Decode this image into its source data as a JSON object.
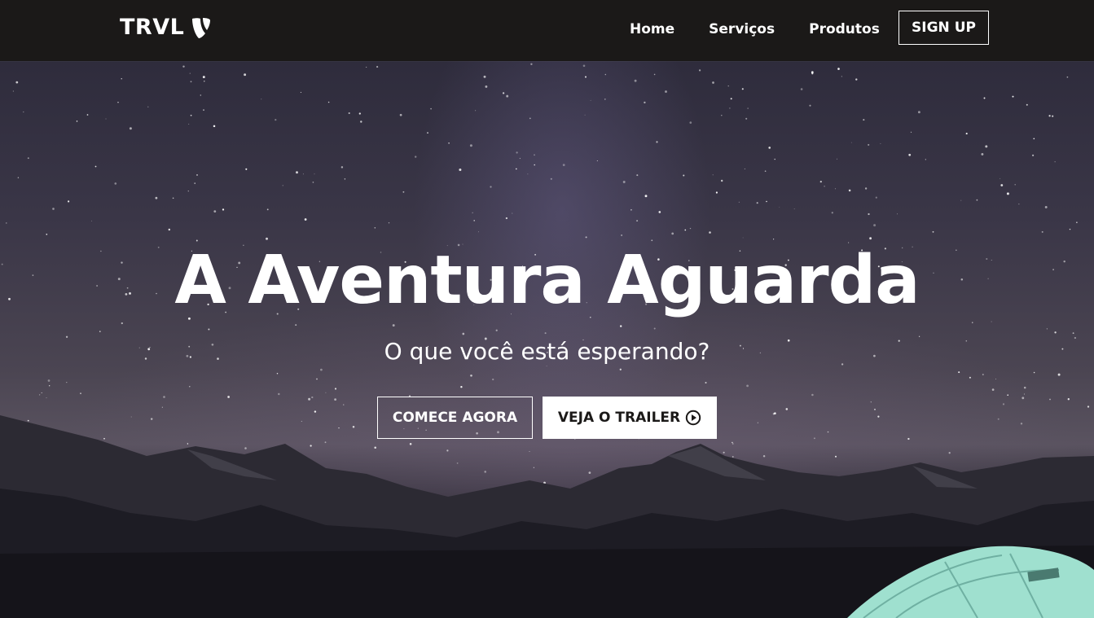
{
  "navbar": {
    "brand": "TRVL",
    "brand_icon": "typo3-logo-icon",
    "links": [
      "Home",
      "Serviços",
      "Produtos"
    ],
    "signup_label": "SIGN UP"
  },
  "hero": {
    "headline": "A Aventura Aguarda",
    "subline": "O que você está esperando?",
    "primary_cta": "COMECE AGORA",
    "secondary_cta": "VEJA O TRAILER",
    "secondary_cta_icon": "play-circle-icon",
    "background": "starry-night-mountains-with-tent"
  },
  "colors": {
    "navbar_bg": "#1b1918",
    "text": "#ffffff",
    "tent": "#9fe0cf"
  }
}
